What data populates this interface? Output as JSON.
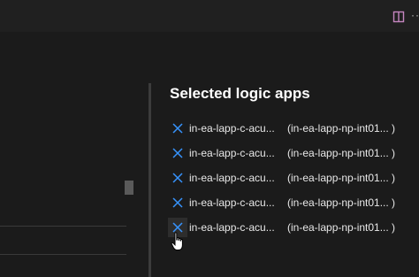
{
  "toolbar": {
    "split_icon": "split-editor-icon",
    "more_label": "···",
    "accent_color": "#c586c0"
  },
  "panel": {
    "title": "Selected logic apps",
    "items": [
      {
        "name": "in-ea-lapp-c-acu...",
        "group": "(in-ea-lapp-np-int01... )"
      },
      {
        "name": "in-ea-lapp-c-acu...",
        "group": "(in-ea-lapp-np-int01... )"
      },
      {
        "name": "in-ea-lapp-c-acu...",
        "group": "(in-ea-lapp-np-int01... )"
      },
      {
        "name": "in-ea-lapp-c-acu...",
        "group": "(in-ea-lapp-np-int01... )"
      },
      {
        "name": "in-ea-lapp-c-acu...",
        "group": "(in-ea-lapp-np-int01... )"
      }
    ],
    "remove_icon": "close-icon",
    "remove_color": "#3794ff"
  }
}
